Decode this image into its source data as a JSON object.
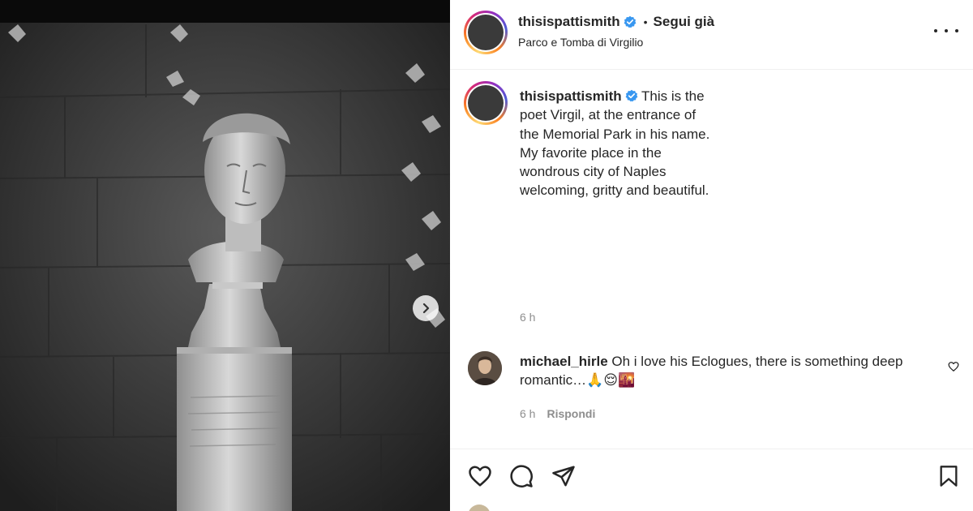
{
  "post": {
    "username": "thisispattismith",
    "follow_label": "Segui già",
    "dot": "•",
    "location": "Parco e Tomba di Virgilio",
    "caption": "This is the poet Virgil, at the entrance of the Memorial Park in his name. My favorite place in the wondrous city of Naples welcoming, gritty and beautiful.",
    "caption_time": "6 h"
  },
  "comment": {
    "username": "michael_hirle",
    "text": "Oh i love his Eclogues, there is something deep romantic…🙏😌🌇",
    "time": "6 h",
    "reply_label": "Rispondi"
  },
  "icons": {
    "verified": "verified-badge-icon",
    "more": "more-options-icon",
    "next": "chevron-right-icon",
    "like": "heart-icon",
    "comment": "comment-bubble-icon",
    "share": "paper-plane-icon",
    "save": "bookmark-icon"
  },
  "colors": {
    "verified": "#3897f0",
    "text": "#262626",
    "secondary": "#8e8e8e"
  }
}
